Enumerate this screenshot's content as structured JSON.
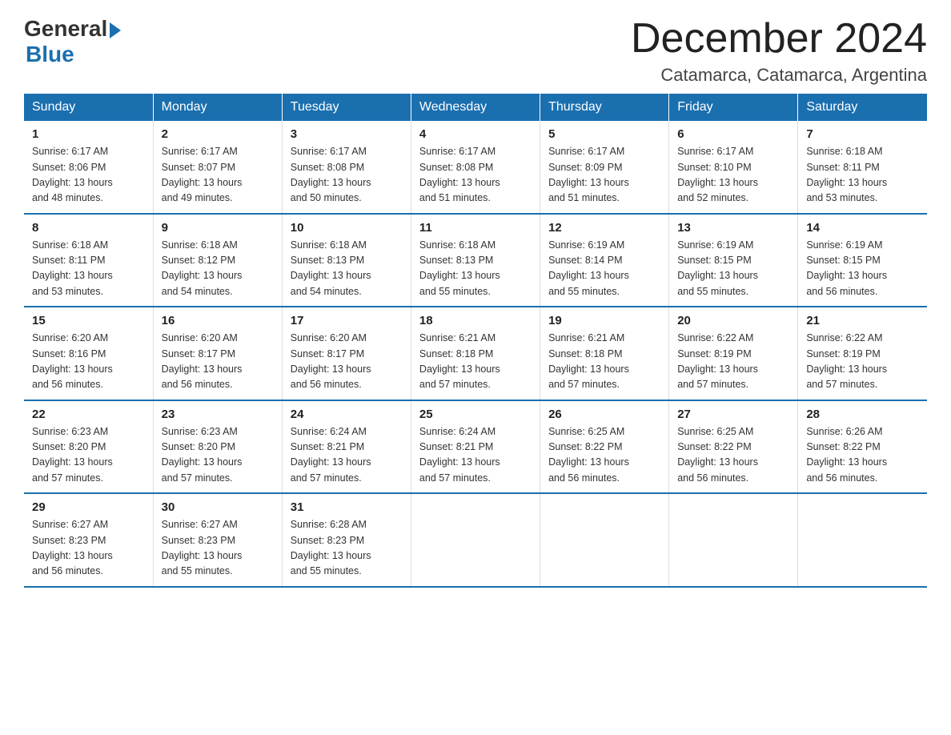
{
  "logo": {
    "general": "General",
    "blue": "Blue"
  },
  "title": "December 2024",
  "location": "Catamarca, Catamarca, Argentina",
  "days_header": [
    "Sunday",
    "Monday",
    "Tuesday",
    "Wednesday",
    "Thursday",
    "Friday",
    "Saturday"
  ],
  "weeks": [
    [
      {
        "num": "1",
        "sunrise": "6:17 AM",
        "sunset": "8:06 PM",
        "daylight": "13 hours and 48 minutes."
      },
      {
        "num": "2",
        "sunrise": "6:17 AM",
        "sunset": "8:07 PM",
        "daylight": "13 hours and 49 minutes."
      },
      {
        "num": "3",
        "sunrise": "6:17 AM",
        "sunset": "8:08 PM",
        "daylight": "13 hours and 50 minutes."
      },
      {
        "num": "4",
        "sunrise": "6:17 AM",
        "sunset": "8:08 PM",
        "daylight": "13 hours and 51 minutes."
      },
      {
        "num": "5",
        "sunrise": "6:17 AM",
        "sunset": "8:09 PM",
        "daylight": "13 hours and 51 minutes."
      },
      {
        "num": "6",
        "sunrise": "6:17 AM",
        "sunset": "8:10 PM",
        "daylight": "13 hours and 52 minutes."
      },
      {
        "num": "7",
        "sunrise": "6:18 AM",
        "sunset": "8:11 PM",
        "daylight": "13 hours and 53 minutes."
      }
    ],
    [
      {
        "num": "8",
        "sunrise": "6:18 AM",
        "sunset": "8:11 PM",
        "daylight": "13 hours and 53 minutes."
      },
      {
        "num": "9",
        "sunrise": "6:18 AM",
        "sunset": "8:12 PM",
        "daylight": "13 hours and 54 minutes."
      },
      {
        "num": "10",
        "sunrise": "6:18 AM",
        "sunset": "8:13 PM",
        "daylight": "13 hours and 54 minutes."
      },
      {
        "num": "11",
        "sunrise": "6:18 AM",
        "sunset": "8:13 PM",
        "daylight": "13 hours and 55 minutes."
      },
      {
        "num": "12",
        "sunrise": "6:19 AM",
        "sunset": "8:14 PM",
        "daylight": "13 hours and 55 minutes."
      },
      {
        "num": "13",
        "sunrise": "6:19 AM",
        "sunset": "8:15 PM",
        "daylight": "13 hours and 55 minutes."
      },
      {
        "num": "14",
        "sunrise": "6:19 AM",
        "sunset": "8:15 PM",
        "daylight": "13 hours and 56 minutes."
      }
    ],
    [
      {
        "num": "15",
        "sunrise": "6:20 AM",
        "sunset": "8:16 PM",
        "daylight": "13 hours and 56 minutes."
      },
      {
        "num": "16",
        "sunrise": "6:20 AM",
        "sunset": "8:17 PM",
        "daylight": "13 hours and 56 minutes."
      },
      {
        "num": "17",
        "sunrise": "6:20 AM",
        "sunset": "8:17 PM",
        "daylight": "13 hours and 56 minutes."
      },
      {
        "num": "18",
        "sunrise": "6:21 AM",
        "sunset": "8:18 PM",
        "daylight": "13 hours and 57 minutes."
      },
      {
        "num": "19",
        "sunrise": "6:21 AM",
        "sunset": "8:18 PM",
        "daylight": "13 hours and 57 minutes."
      },
      {
        "num": "20",
        "sunrise": "6:22 AM",
        "sunset": "8:19 PM",
        "daylight": "13 hours and 57 minutes."
      },
      {
        "num": "21",
        "sunrise": "6:22 AM",
        "sunset": "8:19 PM",
        "daylight": "13 hours and 57 minutes."
      }
    ],
    [
      {
        "num": "22",
        "sunrise": "6:23 AM",
        "sunset": "8:20 PM",
        "daylight": "13 hours and 57 minutes."
      },
      {
        "num": "23",
        "sunrise": "6:23 AM",
        "sunset": "8:20 PM",
        "daylight": "13 hours and 57 minutes."
      },
      {
        "num": "24",
        "sunrise": "6:24 AM",
        "sunset": "8:21 PM",
        "daylight": "13 hours and 57 minutes."
      },
      {
        "num": "25",
        "sunrise": "6:24 AM",
        "sunset": "8:21 PM",
        "daylight": "13 hours and 57 minutes."
      },
      {
        "num": "26",
        "sunrise": "6:25 AM",
        "sunset": "8:22 PM",
        "daylight": "13 hours and 56 minutes."
      },
      {
        "num": "27",
        "sunrise": "6:25 AM",
        "sunset": "8:22 PM",
        "daylight": "13 hours and 56 minutes."
      },
      {
        "num": "28",
        "sunrise": "6:26 AM",
        "sunset": "8:22 PM",
        "daylight": "13 hours and 56 minutes."
      }
    ],
    [
      {
        "num": "29",
        "sunrise": "6:27 AM",
        "sunset": "8:23 PM",
        "daylight": "13 hours and 56 minutes."
      },
      {
        "num": "30",
        "sunrise": "6:27 AM",
        "sunset": "8:23 PM",
        "daylight": "13 hours and 55 minutes."
      },
      {
        "num": "31",
        "sunrise": "6:28 AM",
        "sunset": "8:23 PM",
        "daylight": "13 hours and 55 minutes."
      },
      {
        "num": "",
        "sunrise": "",
        "sunset": "",
        "daylight": ""
      },
      {
        "num": "",
        "sunrise": "",
        "sunset": "",
        "daylight": ""
      },
      {
        "num": "",
        "sunrise": "",
        "sunset": "",
        "daylight": ""
      },
      {
        "num": "",
        "sunrise": "",
        "sunset": "",
        "daylight": ""
      }
    ]
  ],
  "sunrise_label": "Sunrise:",
  "sunset_label": "Sunset:",
  "daylight_label": "Daylight:"
}
